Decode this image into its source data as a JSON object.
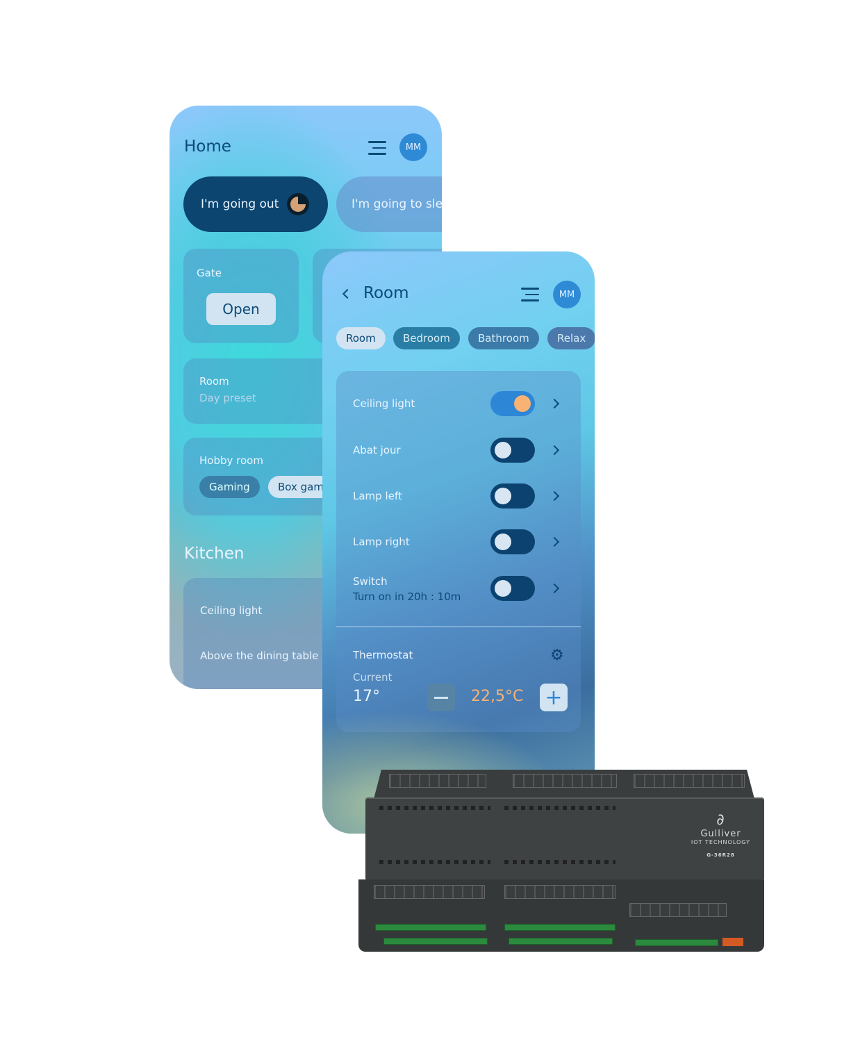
{
  "home": {
    "title": "Home",
    "avatar": "MM",
    "scenes": [
      {
        "label": "I'm going out",
        "active": true
      },
      {
        "label": "I'm going to sle",
        "active": false
      }
    ],
    "gate": {
      "label": "Gate",
      "button": "Open"
    },
    "room_card": {
      "title": "Room",
      "subtitle": "Day preset"
    },
    "hobby": {
      "title": "Hobby room",
      "chips": [
        "Gaming",
        "Box gam"
      ]
    },
    "kitchen": {
      "heading": "Kitchen",
      "items": [
        "Ceiling light",
        "Above the dining table"
      ]
    }
  },
  "room": {
    "title": "Room",
    "avatar": "MM",
    "tabs": [
      {
        "label": "Room",
        "active": true
      },
      {
        "label": "Bedroom"
      },
      {
        "label": "Bathroom"
      },
      {
        "label": "Relax"
      }
    ],
    "devices": [
      {
        "name": "Ceiling light",
        "on": true
      },
      {
        "name": "Abat jour",
        "on": false
      },
      {
        "name": "Lamp left",
        "on": false
      },
      {
        "name": "Lamp right",
        "on": false
      },
      {
        "name": "Switch",
        "sub": "Turn on in 20h : 10m",
        "on": false
      }
    ],
    "thermostat": {
      "title": "Thermostat",
      "current_label": "Current",
      "current": "17°",
      "target": "22,5°C"
    }
  },
  "device": {
    "brand": "Gulliver",
    "tagline": "IOT TECHNOLOGY",
    "model": "G-36R28"
  },
  "colors": {
    "dark_blue": "#0b4270",
    "accent_orange": "#f7b274",
    "accent_blue": "#2e86d6"
  }
}
